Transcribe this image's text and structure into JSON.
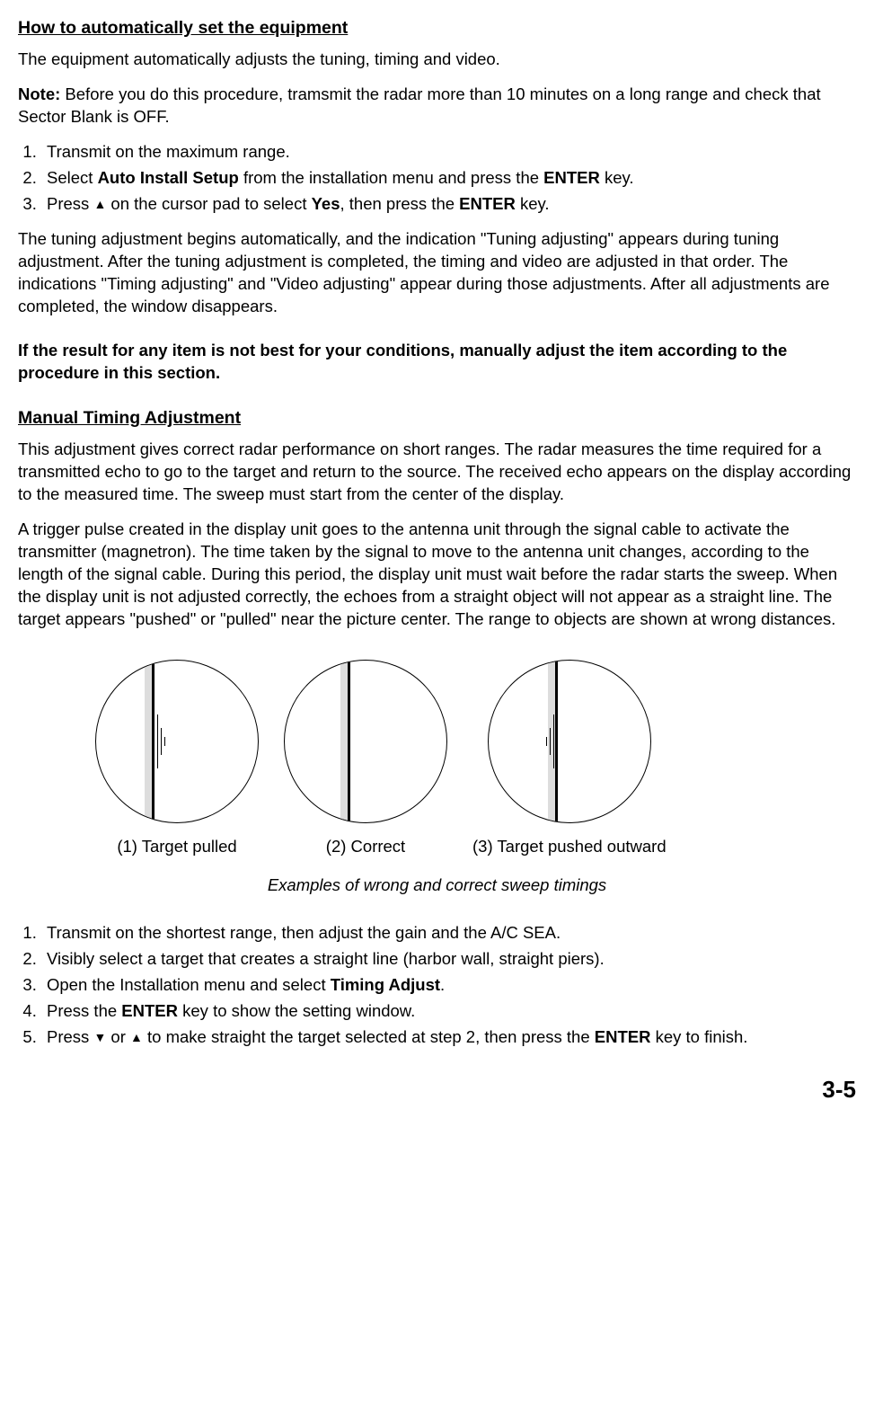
{
  "section1": {
    "heading": "How to automatically set the equipment",
    "p1": "The equipment automatically adjusts the tuning, timing and video.",
    "noteLabel": "Note:",
    "noteText": " Before you do this procedure, tramsmit the radar more than 10 minutes on a long range and check that Sector Blank is OFF.",
    "steps": {
      "s1": "Transmit on the maximum range.",
      "s2a": "Select ",
      "s2b": "Auto Install Setup",
      "s2c": " from the installation menu and press the ",
      "s2d": "ENTER",
      "s2e": " key.",
      "s3a": "Press ",
      "s3tri": "▲",
      "s3b": " on the cursor pad to select ",
      "s3c": "Yes",
      "s3d": ", then press the ",
      "s3e": "ENTER",
      "s3f": " key."
    },
    "p2": "The tuning adjustment begins automatically, and the indication \"Tuning adjusting\" appears during tuning adjustment. After the tuning adjustment is completed, the timing and video are adjusted in that order. The indications \"Timing adjusting\" and \"Video adjusting\" appear during those adjustments. After all adjustments are completed, the window disappears.",
    "p3bold": "If the result for any item is not best for your conditions, manually adjust the item according to the procedure in this section."
  },
  "section2": {
    "heading": "Manual Timing Adjustment",
    "p1": "This adjustment gives correct radar performance on short ranges. The radar measures the time required for a transmitted echo to go to the target and return to the source. The received echo appears on the display according to the measured time. The sweep must start from the center of the display.",
    "p2": "A trigger pulse created in the display unit goes to the antenna unit through the signal cable to activate the transmitter (magnetron). The time taken by the signal to move to the antenna unit changes, according to the length of the signal cable. During this period, the display unit must wait before the radar starts the sweep. When the display unit is not adjusted correctly, the echoes from a straight object will not appear as a straight line. The target appears \"pushed\" or \"pulled\" near the picture center. The range to objects are shown at wrong distances."
  },
  "figure": {
    "cap1": "(1) Target pulled",
    "cap2": "(2) Correct",
    "cap3": "(3) Target pushed outward",
    "main": "Examples of wrong and correct sweep timings"
  },
  "steps2": {
    "s1": "Transmit on the shortest range, then adjust the gain and the A/C SEA.",
    "s2": "Visibly select a target that creates a straight line (harbor wall, straight piers).",
    "s3a": "Open the Installation menu and select ",
    "s3b": "Timing Adjust",
    "s3c": ".",
    "s4a": "Press the ",
    "s4b": "ENTER",
    "s4c": " key to show the setting window.",
    "s5a": "Press ",
    "s5down": "▼",
    "s5b": " or ",
    "s5up": "▲",
    "s5c": " to make straight the target selected at step 2, then press the ",
    "s5d": "ENTER",
    "s5e": " key to finish."
  },
  "pageNumber": "3-5"
}
